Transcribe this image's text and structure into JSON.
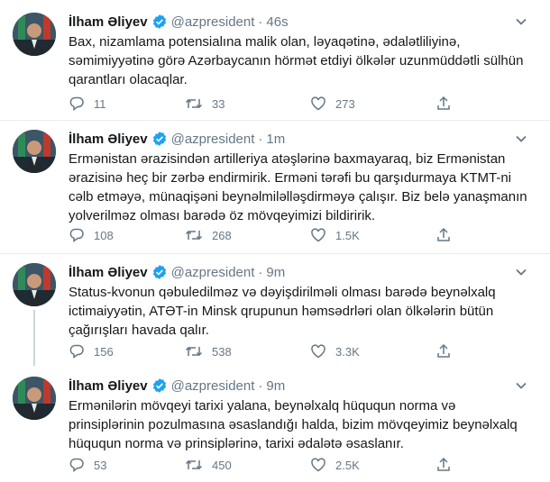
{
  "colors": {
    "name": "#14171a",
    "muted": "#657786",
    "verified": "#1da1f2",
    "divider": "#e6ecf0",
    "thread_line": "#ccd6dd"
  },
  "icons": {
    "verified": "verified-badge-icon",
    "reply": "reply-icon",
    "retweet": "retweet-icon",
    "like": "like-icon",
    "share": "share-icon",
    "more": "chevron-down-icon"
  },
  "tweets": [
    {
      "name": "İlham Əliyev",
      "handle": "@azpresident",
      "dot": "·",
      "time": "46s",
      "text": "Bax, nizamlama potensialına malik olan, ləyaqətinə, ədalətliliyinə,\nsəmimiyyətinə görə Azərbaycanın hörmət etdiyi ölkələr uzunmüddətli sülhün\nqarantları olacaqlar.",
      "replies": "11",
      "retweets": "33",
      "likes": "273"
    },
    {
      "name": "İlham Əliyev",
      "handle": "@azpresident",
      "dot": "·",
      "time": "1m",
      "text": "Ermənistan ərazisindən artilleriya atəşlərinə baxmayaraq, biz Ermənistan\nərazisinə heç bir zərbə endirmirik. Erməni tərəfi bu qarşıdurmaya KTMT-ni\ncəlb etməyə, münaqişəni beynəlmiləlləşdirməyə çalışır. Biz belə yanaşmanın\nyolverilməz olması barədə öz mövqeyimizi bildiririk.",
      "replies": "108",
      "retweets": "268",
      "likes": "1.5K"
    },
    {
      "name": "İlham Əliyev",
      "handle": "@azpresident",
      "dot": "·",
      "time": "9m",
      "text": "Status-kvonun qəbuledilməz və dəyişdirilməli olması barədə beynəlxalq\nictimaiyyətin, ATƏT-in Minsk qrupunun həmsədrləri olan ölkələrin bütün\nçağırışları havada qalır.",
      "replies": "156",
      "retweets": "538",
      "likes": "3.3K"
    },
    {
      "name": "İlham Əliyev",
      "handle": "@azpresident",
      "dot": "·",
      "time": "9m",
      "text": "Ermənilərin mövqeyi tarixi yalana, beynəlxalq hüququn norma və\nprinsiplərinin pozulmasına əsaslandığı halda, bizim mövqeyimiz beynəlxalq\nhüququn norma və prinsiplərinə, tarixi ədalətə əsaslanır.",
      "replies": "53",
      "retweets": "450",
      "likes": "2.5K"
    }
  ]
}
